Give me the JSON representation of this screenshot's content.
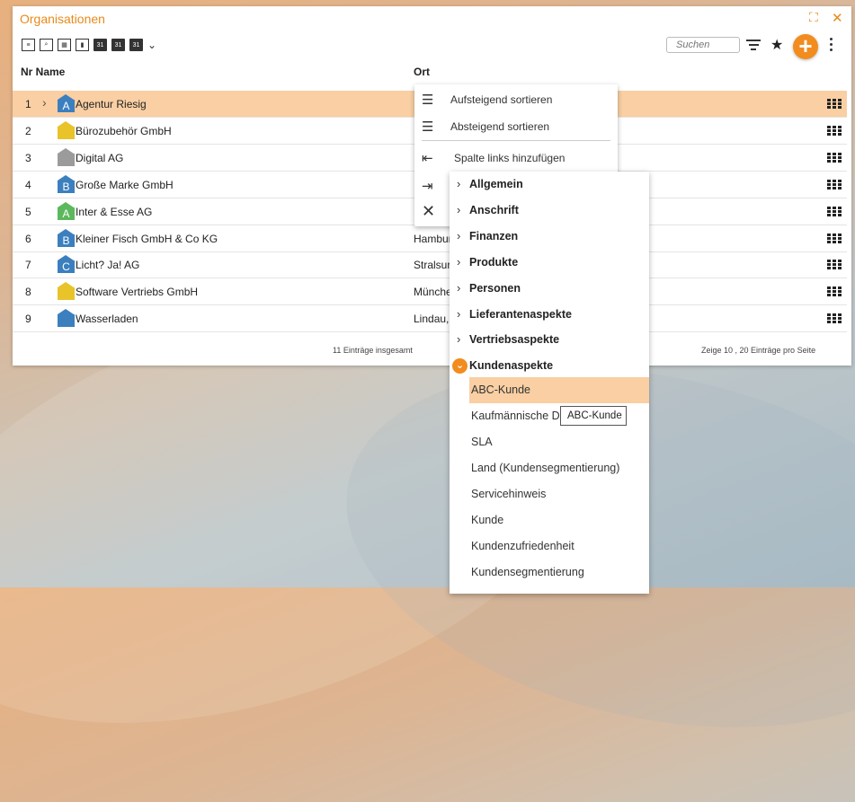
{
  "window": {
    "title": "Organisationen"
  },
  "search": {
    "placeholder": "Suchen"
  },
  "icons": {
    "expand": "expand-icon",
    "close": "close-icon",
    "filter": "filter-icon",
    "star": "star-icon",
    "add": "plus-icon",
    "more": "more-vertical-icon"
  },
  "accent_color": "#f28c1e",
  "table": {
    "headers": {
      "nr_name": "Nr Name",
      "ort": "Ort"
    },
    "rows": [
      {
        "nr": "1",
        "name": "Agentur Riesig",
        "letter": "A",
        "color": "#3b7fbf",
        "ort": ""
      },
      {
        "nr": "2",
        "name": "Bürozubehör GmbH",
        "letter": "",
        "color": "#e8c32a",
        "ort": ""
      },
      {
        "nr": "3",
        "name": "Digital AG",
        "letter": "",
        "color": "#9b9b9b",
        "ort": ""
      },
      {
        "nr": "4",
        "name": "Große Marke GmbH",
        "letter": "B",
        "color": "#3b7fbf",
        "ort": ""
      },
      {
        "nr": "5",
        "name": "Inter & Esse AG",
        "letter": "A",
        "color": "#5cb85c",
        "ort": ""
      },
      {
        "nr": "6",
        "name": "Kleiner Fisch GmbH & Co KG",
        "letter": "B",
        "color": "#3b7fbf",
        "ort": "Hambur"
      },
      {
        "nr": "7",
        "name": "Licht? Ja! AG",
        "letter": "C",
        "color": "#3b7fbf",
        "ort": "Stralsur"
      },
      {
        "nr": "8",
        "name": "Software Vertriebs GmbH",
        "letter": "",
        "color": "#e8c32a",
        "ort": "Münche"
      },
      {
        "nr": "9",
        "name": "Wasserladen",
        "letter": "",
        "color": "#3b7fbf",
        "ort": "Lindau,"
      }
    ]
  },
  "footer": {
    "total": "11 Einträge insgesamt",
    "page": "Zeige  10 ,  20  Einträge pro Seite"
  },
  "column_menu": {
    "items": [
      {
        "label": "Aufsteigend sortieren",
        "icon": "sort-asc-icon"
      },
      {
        "label": "Absteigend sortieren",
        "icon": "sort-desc-icon"
      },
      {
        "label": "Spalte links hinzufügen",
        "icon": "add-left-icon"
      }
    ]
  },
  "field_menu": {
    "categories": [
      "Allgemein",
      "Anschrift",
      "Finanzen",
      "Produkte",
      "Personen",
      "Lieferantenaspekte",
      "Vertriebsaspekte"
    ],
    "open_category": "Kundenaspekte",
    "open_items": [
      "ABC-Kunde",
      "Kaufmännische D",
      "SLA",
      "Land (Kundensegmentierung)",
      "Servicehinweis",
      "Kunde",
      "Kundenzufriedenheit",
      "Kundensegmentierung"
    ]
  },
  "tooltip": {
    "text": "ABC-Kunde"
  }
}
